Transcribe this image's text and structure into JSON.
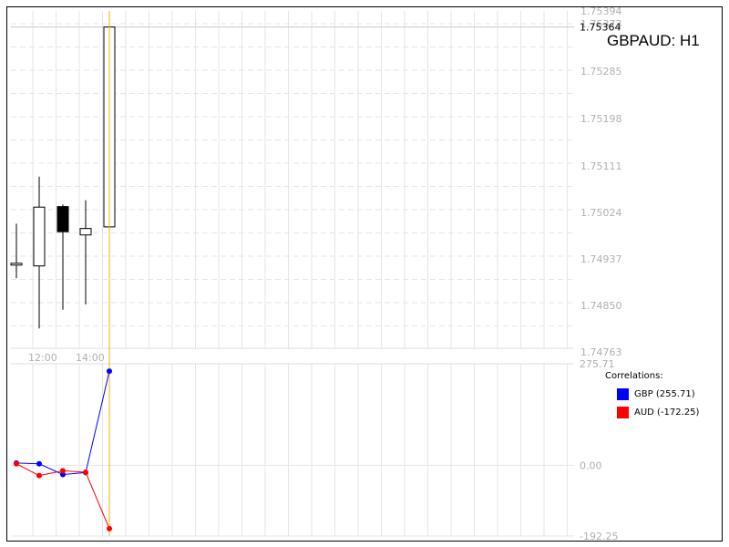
{
  "title": "GBPAUD: H1",
  "price_axis": {
    "ticks": [
      "1.75394",
      "1.75373",
      "1.75285",
      "1.75198",
      "1.75111",
      "1.75024",
      "1.74937",
      "1.74850",
      "1.74763"
    ],
    "current_price_label": "1.75364"
  },
  "time_axis": {
    "ticks": [
      "12:00",
      "14:00"
    ]
  },
  "indicator_axis": {
    "ticks": [
      "275.71",
      "0.00",
      "-192.25"
    ]
  },
  "legend": {
    "title": "Correlations:",
    "items": [
      {
        "label": "GBP (255.71)",
        "color": "#0000ff"
      },
      {
        "label": "AUD (-172.25)",
        "color": "#ff0000"
      }
    ]
  },
  "colors": {
    "cursor_line": "#f0b400",
    "grid": "#e6e6e6",
    "bull": "#ffffff",
    "bear": "#000000"
  },
  "chart_data": [
    {
      "type": "candlestick",
      "title": "GBPAUD: H1",
      "ylim": [
        1.74763,
        1.75394
      ],
      "candles": [
        {
          "open": 1.74919,
          "high": 1.74996,
          "low": 1.74894,
          "close": 1.74922
        },
        {
          "open": 1.74917,
          "high": 1.75084,
          "low": 1.748,
          "close": 1.75027
        },
        {
          "open": 1.75028,
          "high": 1.75032,
          "low": 1.74835,
          "close": 1.74981
        },
        {
          "open": 1.74975,
          "high": 1.7504,
          "low": 1.74845,
          "close": 1.74987
        },
        {
          "open": 1.7499,
          "high": 1.7499,
          "low": 1.74932,
          "close": 1.75364
        }
      ]
    },
    {
      "type": "line",
      "title": "Correlations:",
      "ylim": [
        -192.25,
        275.71
      ],
      "series": [
        {
          "name": "GBP (255.71)",
          "color": "#0000ff",
          "values": [
            6,
            4,
            -25,
            -20,
            255.71
          ]
        },
        {
          "name": "AUD (-172.25)",
          "color": "#ff0000",
          "values": [
            4,
            -28,
            -15,
            -19,
            -172.25
          ]
        }
      ]
    }
  ]
}
